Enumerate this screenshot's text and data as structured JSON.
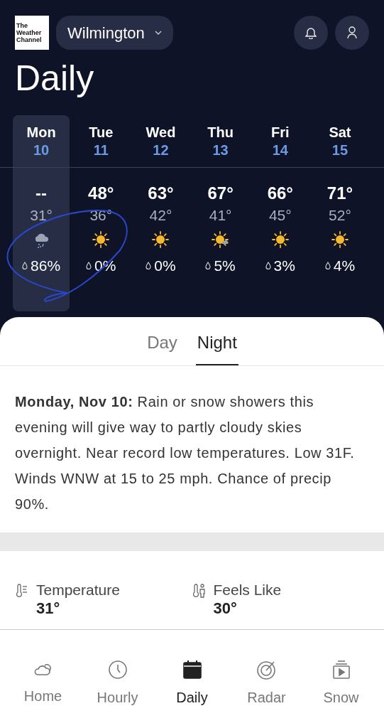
{
  "header": {
    "logo_lines": [
      "The",
      "Weather",
      "Channel"
    ],
    "location": "Wilmington",
    "title": "Daily"
  },
  "days": [
    {
      "day": "Mon",
      "date": "10",
      "high": "--",
      "low": "31°",
      "kind": "rain-snow",
      "precip": "86%",
      "selected": true
    },
    {
      "day": "Tue",
      "date": "11",
      "high": "48°",
      "low": "36°",
      "kind": "sun",
      "precip": "0%",
      "selected": false
    },
    {
      "day": "Wed",
      "date": "12",
      "high": "63°",
      "low": "42°",
      "kind": "sun",
      "precip": "0%",
      "selected": false
    },
    {
      "day": "Thu",
      "date": "13",
      "high": "67°",
      "low": "41°",
      "kind": "sun-cloud",
      "precip": "5%",
      "selected": false
    },
    {
      "day": "Fri",
      "date": "14",
      "high": "66°",
      "low": "45°",
      "kind": "sun",
      "precip": "3%",
      "selected": false
    },
    {
      "day": "Sat",
      "date": "15",
      "high": "71°",
      "low": "52°",
      "kind": "sun",
      "precip": "4%",
      "selected": false
    }
  ],
  "period_tabs": [
    {
      "label": "Day",
      "selected": false
    },
    {
      "label": "Night",
      "selected": true
    }
  ],
  "forecast": "**Monday, Nov 10:** Rain or snow showers this evening will give way to partly cloudy skies overnight. Near record low temperatures. Low 31F. Winds WNW at 15 to 25 mph. Chance of precip 90%.",
  "details": [
    {
      "kind": "temperature",
      "label": "Temperature",
      "value": "31°"
    },
    {
      "kind": "feels-like",
      "label": "Feels Like",
      "value": "30°"
    }
  ],
  "nav": [
    {
      "label": "Home",
      "kind": "home",
      "selected": false
    },
    {
      "label": "Hourly",
      "kind": "hourly",
      "selected": false
    },
    {
      "label": "Daily",
      "kind": "daily",
      "selected": true
    },
    {
      "label": "Radar",
      "kind": "radar",
      "selected": false
    },
    {
      "label": "Snow",
      "kind": "snow",
      "selected": false
    }
  ]
}
